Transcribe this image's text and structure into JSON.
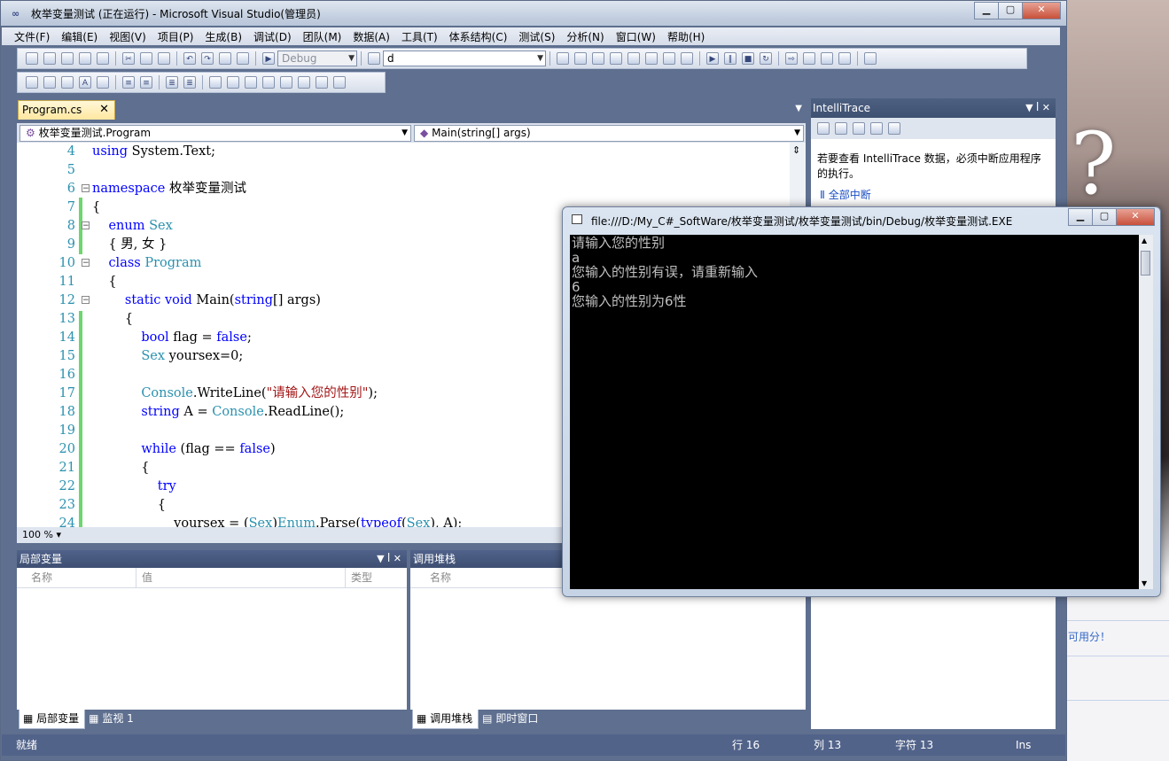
{
  "window": {
    "title": "枚举变量测试 (正在运行) - Microsoft Visual Studio(管理员)"
  },
  "menu": [
    "文件(F)",
    "编辑(E)",
    "视图(V)",
    "项目(P)",
    "生成(B)",
    "调试(D)",
    "团队(M)",
    "数据(A)",
    "工具(T)",
    "体系结构(C)",
    "测试(S)",
    "分析(N)",
    "窗口(W)",
    "帮助(H)"
  ],
  "toolbar": {
    "config": "Debug",
    "find_value": "d"
  },
  "doc_tab": {
    "label": "Program.cs",
    "close": "✕"
  },
  "navbar": {
    "type": "枚举变量测试.Program",
    "member": "Main(string[] args)"
  },
  "code_lines": [
    {
      "n": "4",
      "t": "using System.Text;"
    },
    {
      "n": "5",
      "t": ""
    },
    {
      "n": "6",
      "t": "namespace 枚举变量测试"
    },
    {
      "n": "7",
      "t": "{"
    },
    {
      "n": "8",
      "t": "    enum Sex"
    },
    {
      "n": "9",
      "t": "    { 男, 女 }"
    },
    {
      "n": "10",
      "t": "    class Program"
    },
    {
      "n": "11",
      "t": "    {"
    },
    {
      "n": "12",
      "t": "        static void Main(string[] args)"
    },
    {
      "n": "13",
      "t": "        {"
    },
    {
      "n": "14",
      "t": "            bool flag = false;"
    },
    {
      "n": "15",
      "t": "            Sex yoursex=0;"
    },
    {
      "n": "16",
      "t": ""
    },
    {
      "n": "17",
      "t": "            Console.WriteLine(\"请输入您的性别\");"
    },
    {
      "n": "18",
      "t": "            string A = Console.ReadLine();"
    },
    {
      "n": "19",
      "t": ""
    },
    {
      "n": "20",
      "t": "            while (flag == false)"
    },
    {
      "n": "21",
      "t": "            {"
    },
    {
      "n": "22",
      "t": "                try"
    },
    {
      "n": "23",
      "t": "                {"
    },
    {
      "n": "24",
      "t": "                    yoursex = (Sex)Enum.Parse(typeof(Sex), A);"
    }
  ],
  "zoom": "100 %",
  "intellitrace": {
    "title": "IntelliTrace",
    "message": "若要查看 IntelliTrace 数据，必须中断应用程序的执行。",
    "link": "全部中断"
  },
  "locals": {
    "title": "局部变量",
    "col_name": "名称",
    "col_value": "值",
    "col_type": "类型",
    "tab1": "局部变量",
    "tab2": "监视 1"
  },
  "callstack": {
    "title": "调用堆栈",
    "col_name": "名称",
    "tab1": "调用堆栈",
    "tab2": "即时窗口"
  },
  "status": {
    "left": "就绪",
    "line": "行 16",
    "col": "列 13",
    "char": "字符 13",
    "mode": "Ins"
  },
  "console": {
    "title": "file:///D:/My_C#_SoftWare/枚举变量测试/枚举变量测试/bin/Debug/枚举变量测试.EXE",
    "lines": [
      "请输入您的性别",
      "a",
      "您输入的性别有误，请重新输入",
      "6",
      "您输入的性别为6性"
    ]
  },
  "desktop": {
    "snippet": "可用分！"
  }
}
